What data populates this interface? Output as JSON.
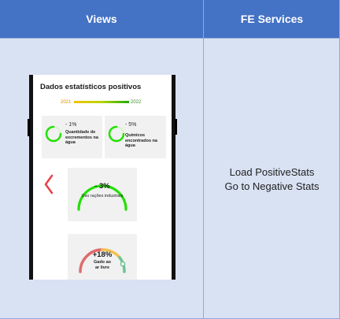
{
  "columns": {
    "views": "Views",
    "fe_services": "FE Services"
  },
  "fe_services": {
    "line1": "Load PositiveStats",
    "line2": "Go to Negative Stats"
  },
  "screen": {
    "title": "Dados estatísticos positivos",
    "year_start": "2021",
    "year_end": "2022",
    "cards": [
      {
        "value": "- 1%",
        "label": "Quantidade de excrementos na água"
      },
      {
        "value": "- 5%",
        "label": "Químicos encontrados na água"
      },
      {
        "value": "- 3%",
        "label": "Uso rações industrais"
      },
      {
        "value": "+18%",
        "label": "Gado ao ar livre"
      }
    ]
  },
  "colors": {
    "header": "#4472c4",
    "background": "#d9e2f3",
    "ring_green": "#22e000",
    "chevron": "#e8404a"
  },
  "icons": [
    "chevron-left-icon"
  ]
}
